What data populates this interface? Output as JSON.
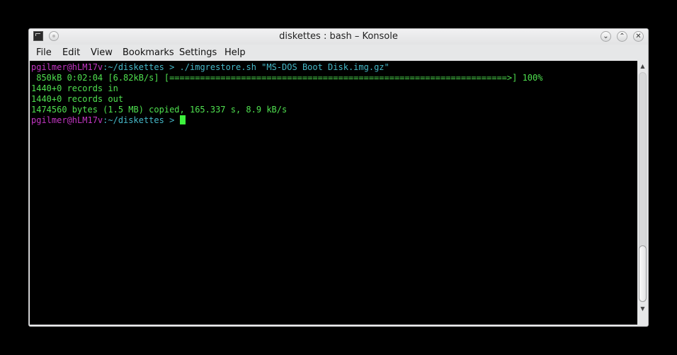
{
  "window": {
    "title": "diskettes : bash – Konsole",
    "buttons": {
      "minimize": "⌄",
      "maximize": "⌃",
      "close": "✕"
    }
  },
  "menu": [
    "File",
    "Edit",
    "View",
    "Bookmarks",
    "Settings",
    "Help"
  ],
  "terminal": {
    "lines": [
      {
        "user": "pgilmer@hLM17v",
        "path": ":~/diskettes",
        "prompt": " > ",
        "cmd": "./imgrestore.sh \"MS-DOS Boot Disk.img.gz\""
      },
      {
        "text": " 850kB 0:02:04 [6.82kB/s] [==================================================================>] 100%"
      },
      {
        "text": "1440+0 records in"
      },
      {
        "text": "1440+0 records out"
      },
      {
        "text": "1474560 bytes (1.5 MB) copied, 165.337 s, 8.9 kB/s"
      },
      {
        "user": "pgilmer@hLM17v",
        "path": ":~/diskettes",
        "prompt": " > "
      }
    ]
  },
  "colors": {
    "user": "#c436c4",
    "path": "#45b7c7",
    "output": "#4fe04f",
    "cursor": "#3df23d"
  },
  "icons": [
    "terminal-app-icon",
    "pin-icon",
    "minimize-icon",
    "maximize-icon",
    "close-icon",
    "scroll-up-icon",
    "scroll-down-icon"
  ]
}
